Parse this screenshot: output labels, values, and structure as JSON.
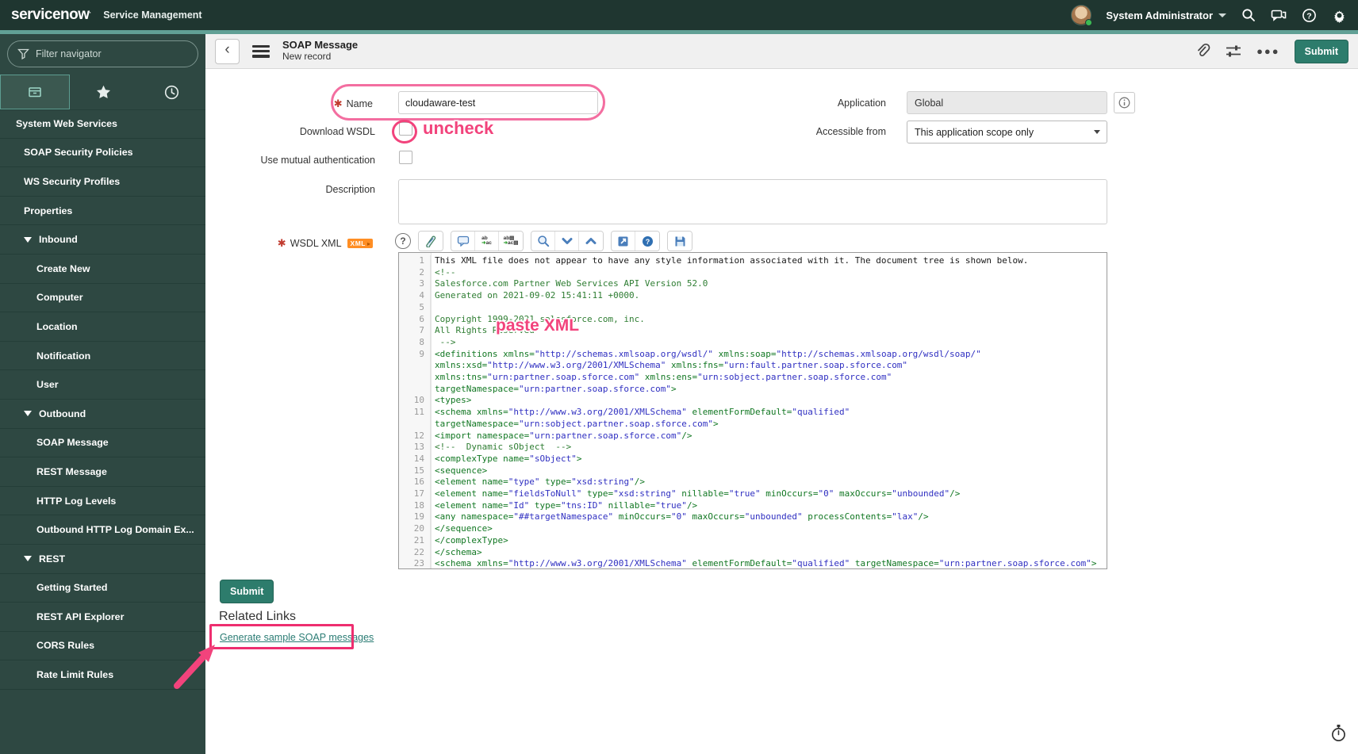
{
  "header": {
    "brand": "servicenow",
    "product": "Service Management",
    "user": "System Administrator"
  },
  "sidebar": {
    "filter_placeholder": "Filter navigator",
    "items": [
      {
        "label": "System Web Services",
        "level": 0,
        "arrow": false
      },
      {
        "label": "SOAP Security Policies",
        "level": 1,
        "arrow": false
      },
      {
        "label": "WS Security Profiles",
        "level": 1,
        "arrow": false
      },
      {
        "label": "Properties",
        "level": 1,
        "arrow": false
      },
      {
        "label": "Inbound",
        "level": 1,
        "arrow": true
      },
      {
        "label": "Create New",
        "level": 2,
        "arrow": false
      },
      {
        "label": "Computer",
        "level": 2,
        "arrow": false
      },
      {
        "label": "Location",
        "level": 2,
        "arrow": false
      },
      {
        "label": "Notification",
        "level": 2,
        "arrow": false
      },
      {
        "label": "User",
        "level": 2,
        "arrow": false
      },
      {
        "label": "Outbound",
        "level": 1,
        "arrow": true
      },
      {
        "label": "SOAP Message",
        "level": 2,
        "arrow": false
      },
      {
        "label": "REST Message",
        "level": 2,
        "arrow": false
      },
      {
        "label": "HTTP Log Levels",
        "level": 2,
        "arrow": false
      },
      {
        "label": "Outbound HTTP Log Domain Ex...",
        "level": 2,
        "arrow": false
      },
      {
        "label": "REST",
        "level": 1,
        "arrow": true
      },
      {
        "label": "Getting Started",
        "level": 2,
        "arrow": false
      },
      {
        "label": "REST API Explorer",
        "level": 2,
        "arrow": false
      },
      {
        "label": "CORS Rules",
        "level": 2,
        "arrow": false
      },
      {
        "label": "Rate Limit Rules",
        "level": 2,
        "arrow": false
      }
    ]
  },
  "form_header": {
    "title": "SOAP Message",
    "subtitle": "New record",
    "submit_label": "Submit"
  },
  "form": {
    "name": {
      "label": "Name",
      "value": "cloudaware-test"
    },
    "application": {
      "label": "Application",
      "value": "Global"
    },
    "download_wsdl": {
      "label": "Download WSDL"
    },
    "accessible_from": {
      "label": "Accessible from",
      "value": "This application scope only"
    },
    "use_mutual_auth": {
      "label": "Use mutual authentication"
    },
    "description": {
      "label": "Description"
    },
    "wsdl_xml": {
      "label": "WSDL XML",
      "badge": "XML"
    }
  },
  "footer": {
    "submit_label": "Submit",
    "related_links_title": "Related Links",
    "link_label": "Generate sample SOAP messages"
  },
  "annotations": {
    "uncheck_text": "uncheck",
    "paste_xml_text": "paste XML",
    "pink": "#f2437c",
    "ring_pink": "#f36ea0",
    "box_pink": "#ee2e6f"
  },
  "editor": {
    "colors": {
      "comment": "#2e7d32",
      "tag": "#117722",
      "value": "#2f2fc1",
      "plain": "#1a1a1a"
    },
    "lines": [
      {
        "n": "1",
        "t": "plain",
        "s": "This XML file does not appear to have any style information associated with it. The document tree is shown below."
      },
      {
        "n": "2",
        "t": "comment",
        "s": "<!--"
      },
      {
        "n": "3",
        "t": "comment",
        "s": "Salesforce.com Partner Web Services API Version 52.0"
      },
      {
        "n": "4",
        "t": "comment",
        "s": "Generated on 2021-09-02 15:41:11 +0000."
      },
      {
        "n": "5",
        "t": "comment",
        "s": ""
      },
      {
        "n": "6",
        "t": "comment",
        "s": "Copyright 1999-2021 salesforce.com, inc."
      },
      {
        "n": "7",
        "t": "comment",
        "s": "All Rights Reserved"
      },
      {
        "n": "8",
        "t": "comment",
        "s": " -->"
      },
      {
        "n": "9",
        "t": "markup",
        "s": "<definitions xmlns=\"http://schemas.xmlsoap.org/wsdl/\" xmlns:soap=\"http://schemas.xmlsoap.org/wsdl/soap/\" xmlns:xsd=\"http://www.w3.org/2001/XMLSchema\" xmlns:fns=\"urn:fault.partner.soap.sforce.com\" xmlns:tns=\"urn:partner.soap.sforce.com\" xmlns:ens=\"urn:sobject.partner.soap.sforce.com\" targetNamespace=\"urn:partner.soap.sforce.com\">"
      },
      {
        "n": "10",
        "t": "markup",
        "s": "<types>"
      },
      {
        "n": "11",
        "t": "markup",
        "s": "<schema xmlns=\"http://www.w3.org/2001/XMLSchema\" elementFormDefault=\"qualified\" targetNamespace=\"urn:sobject.partner.soap.sforce.com\">"
      },
      {
        "n": "12",
        "t": "markup",
        "s": "<import namespace=\"urn:partner.soap.sforce.com\"/>"
      },
      {
        "n": "13",
        "t": "comment",
        "s": "<!--  Dynamic sObject  -->"
      },
      {
        "n": "14",
        "t": "markup",
        "s": "<complexType name=\"sObject\">"
      },
      {
        "n": "15",
        "t": "markup",
        "s": "<sequence>"
      },
      {
        "n": "16",
        "t": "markup",
        "s": "<element name=\"type\" type=\"xsd:string\"/>"
      },
      {
        "n": "17",
        "t": "markup",
        "s": "<element name=\"fieldsToNull\" type=\"xsd:string\" nillable=\"true\" minOccurs=\"0\" maxOccurs=\"unbounded\"/>"
      },
      {
        "n": "18",
        "t": "markup",
        "s": "<element name=\"Id\" type=\"tns:ID\" nillable=\"true\"/>"
      },
      {
        "n": "19",
        "t": "markup",
        "s": "<any namespace=\"##targetNamespace\" minOccurs=\"0\" maxOccurs=\"unbounded\" processContents=\"lax\"/>"
      },
      {
        "n": "20",
        "t": "markup",
        "s": "</sequence>"
      },
      {
        "n": "21",
        "t": "markup",
        "s": "</complexType>"
      },
      {
        "n": "22",
        "t": "markup",
        "s": "</schema>"
      },
      {
        "n": "23",
        "t": "markup",
        "s": "<schema xmlns=\"http://www.w3.org/2001/XMLSchema\" elementFormDefault=\"qualified\" targetNamespace=\"urn:partner.soap.sforce.com\">"
      }
    ]
  }
}
